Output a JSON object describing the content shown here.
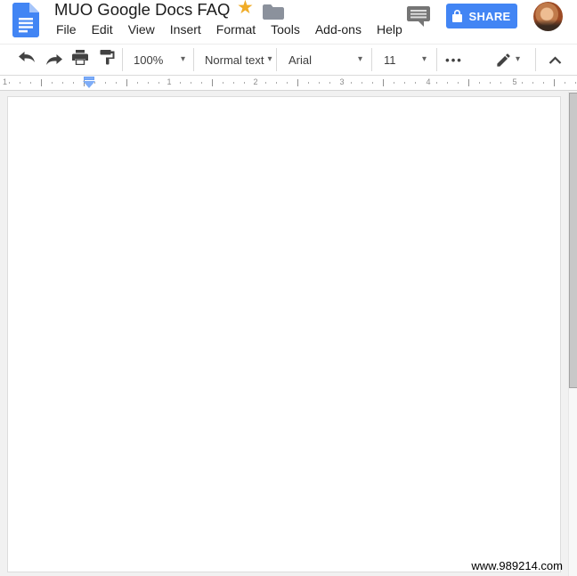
{
  "header": {
    "title": "MUO Google Docs FAQ",
    "menu": [
      "File",
      "Edit",
      "View",
      "Insert",
      "Format",
      "Tools",
      "Add-ons",
      "Help"
    ],
    "share_label": "SHARE"
  },
  "toolbar": {
    "zoom_value": "100%",
    "paragraph_style_value": "Normal text",
    "font_family_value": "Arial",
    "font_size_value": "11",
    "more_label": "•••"
  },
  "ruler": {
    "numbers": [
      "1",
      "1",
      "2",
      "3",
      "4",
      "5"
    ]
  },
  "document": {
    "watermark": "www.989214.com"
  },
  "icons": {
    "star": "★",
    "caret_down": "▾"
  },
  "colors": {
    "accent_blue": "#4285f4",
    "star_gold": "#f0ac27",
    "icon_gray": "#424242",
    "ruler_marker_blue": "#7fadf7",
    "canvas_gray": "#f1f1f1"
  }
}
